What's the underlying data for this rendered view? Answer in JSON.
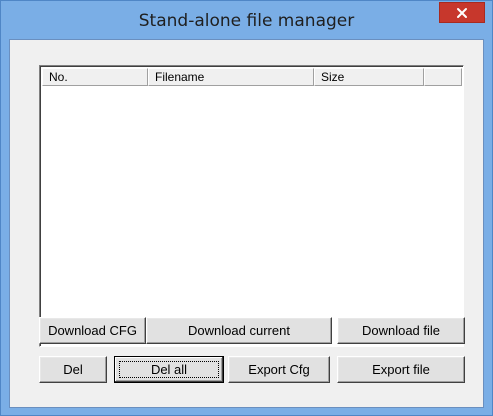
{
  "window": {
    "title": "Stand-alone file manager",
    "close_glyph": "✕"
  },
  "file_list": {
    "columns": [
      "No.",
      "Filename",
      "Size",
      ""
    ],
    "rows": []
  },
  "buttons": {
    "download_cfg": "Download CFG",
    "download_current": "Download current",
    "download_file": "Download file",
    "del": "Del",
    "del_all": "Del all",
    "export_cfg": "Export Cfg",
    "export_file": "Export file"
  },
  "colors": {
    "frame": "#7aaee6",
    "close_button": "#c7372c",
    "client_bg": "#f0f0f0"
  }
}
